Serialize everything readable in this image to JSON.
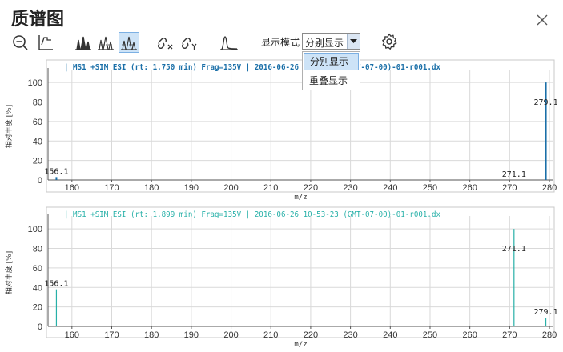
{
  "window": {
    "title": "质谱图",
    "close_icon": "close-icon"
  },
  "toolbar": {
    "icons": [
      "zoom-out-icon",
      "auto-scale-icon",
      "spectrum-view-1-icon",
      "spectrum-view-2-icon",
      "spectrum-view-3-icon",
      "unlink-x-icon",
      "unlink-y-icon",
      "peak-icon",
      "settings-icon"
    ],
    "display_mode_label": "显示模式",
    "display_mode_value": "分别显示",
    "display_mode_options": [
      "分别显示",
      "重叠显示"
    ]
  },
  "colors": {
    "plot1": "#1a6fa8",
    "plot2": "#27b0a8",
    "grid": "#d9d9d9",
    "dropdown_highlight": "#cde3f7"
  },
  "chart_data": [
    {
      "type": "bar",
      "title": "| MS1 +SIM ESI (rt: 1.750 min) Frag=135V | 2016-06-26 10-53-23 (GMT-07-00)-01-r001.dx",
      "xlabel": "m/z",
      "ylabel": "相对丰度 [%]",
      "xlim": [
        154,
        281
      ],
      "ylim": [
        0,
        110
      ],
      "xticks": [
        160,
        170,
        180,
        190,
        200,
        210,
        220,
        230,
        240,
        250,
        260,
        270,
        280
      ],
      "yticks": [
        0,
        20,
        40,
        60,
        80,
        100
      ],
      "grid": true,
      "color": "#1a6fa8",
      "peaks": [
        {
          "x": 156.1,
          "y": 3,
          "label": "156.1"
        },
        {
          "x": 271.1,
          "y": 0,
          "label": "271.1"
        },
        {
          "x": 279.1,
          "y": 100,
          "label": "279.1"
        }
      ]
    },
    {
      "type": "bar",
      "title": "| MS1 +SIM ESI (rt: 1.899 min) Frag=135V | 2016-06-26 10-53-23 (GMT-07-00)-01-r001.dx",
      "xlabel": "m/z",
      "ylabel": "相对丰度 [%]",
      "xlim": [
        154,
        281
      ],
      "ylim": [
        0,
        110
      ],
      "xticks": [
        160,
        170,
        180,
        190,
        200,
        210,
        220,
        230,
        240,
        250,
        260,
        270,
        280
      ],
      "yticks": [
        0,
        20,
        40,
        60,
        80,
        100
      ],
      "grid": true,
      "color": "#27b0a8",
      "peaks": [
        {
          "x": 156.1,
          "y": 38,
          "label": "156.1"
        },
        {
          "x": 271.1,
          "y": 100,
          "label": "271.1"
        },
        {
          "x": 279.1,
          "y": 9,
          "label": "279.1"
        }
      ]
    }
  ]
}
